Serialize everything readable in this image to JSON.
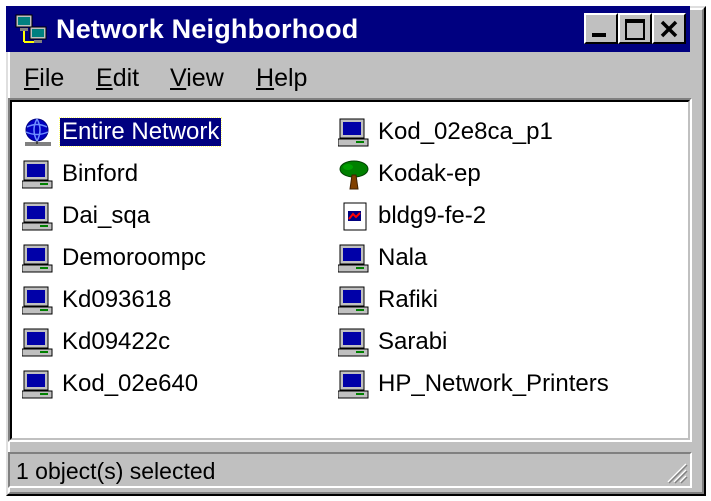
{
  "window": {
    "title": "Network Neighborhood",
    "title_icon": "network-neighborhood-icon",
    "controls": {
      "minimize": "minimize-icon",
      "maximize": "maximize-icon",
      "close": "close-icon"
    }
  },
  "menu": [
    {
      "label": "File",
      "underline": "F"
    },
    {
      "label": "Edit",
      "underline": "E"
    },
    {
      "label": "View",
      "underline": "V"
    },
    {
      "label": "Help",
      "underline": "H"
    }
  ],
  "items": [
    {
      "label": "Entire Network",
      "icon": "globe-network-icon",
      "selected": true
    },
    {
      "label": "Binford",
      "icon": "computer-icon"
    },
    {
      "label": "Dai_sqa",
      "icon": "computer-icon"
    },
    {
      "label": "Demoroompc",
      "icon": "computer-icon"
    },
    {
      "label": "Kd093618",
      "icon": "computer-icon"
    },
    {
      "label": "Kd09422c",
      "icon": "computer-icon"
    },
    {
      "label": "Kod_02e640",
      "icon": "computer-icon"
    },
    {
      "label": "Kod_02e8ca_p1",
      "icon": "computer-icon"
    },
    {
      "label": "Kodak-ep",
      "icon": "tree-icon"
    },
    {
      "label": "bldg9-fe-2",
      "icon": "document-icon"
    },
    {
      "label": "Nala",
      "icon": "computer-icon"
    },
    {
      "label": "Rafiki",
      "icon": "computer-icon"
    },
    {
      "label": "Sarabi",
      "icon": "computer-icon"
    },
    {
      "label": "HP_Network_Printers",
      "icon": "computer-icon"
    }
  ],
  "status": {
    "text": "1 object(s) selected"
  },
  "colors": {
    "titlebar": "#000080",
    "face": "#c0c0c0",
    "selection": "#000080"
  }
}
